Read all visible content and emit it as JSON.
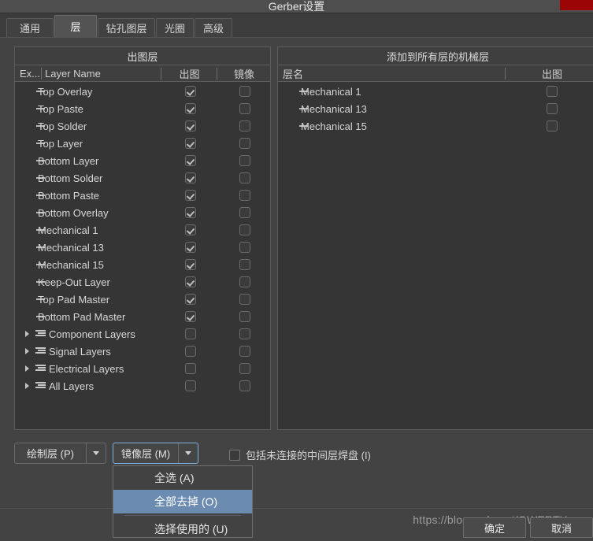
{
  "window": {
    "title": "Gerber设置",
    "close_icon": "close-icon",
    "accent_blue": "#6b8cb0",
    "close_red": "#9c0506"
  },
  "tabs": [
    {
      "label": "通用",
      "active": false
    },
    {
      "label": "层",
      "active": true
    },
    {
      "label": "钻孔图层",
      "active": false
    },
    {
      "label": "光圈",
      "active": false
    },
    {
      "label": "高级",
      "active": false
    }
  ],
  "left_panel": {
    "title": "出图层",
    "columns": [
      "Ex...",
      "Layer Name",
      "出图",
      "镜像"
    ],
    "rows": [
      {
        "name": "Top Overlay",
        "type": "layer",
        "plot": true,
        "mirror": false
      },
      {
        "name": "Top Paste",
        "type": "layer",
        "plot": true,
        "mirror": false
      },
      {
        "name": "Top Solder",
        "type": "layer",
        "plot": true,
        "mirror": false
      },
      {
        "name": "Top Layer",
        "type": "layer",
        "plot": true,
        "mirror": false
      },
      {
        "name": "Bottom Layer",
        "type": "layer",
        "plot": true,
        "mirror": false
      },
      {
        "name": "Bottom Solder",
        "type": "layer",
        "plot": true,
        "mirror": false
      },
      {
        "name": "Bottom Paste",
        "type": "layer",
        "plot": true,
        "mirror": false
      },
      {
        "name": "Bottom Overlay",
        "type": "layer",
        "plot": true,
        "mirror": false
      },
      {
        "name": "Mechanical 1",
        "type": "layer",
        "plot": true,
        "mirror": false
      },
      {
        "name": "Mechanical 13",
        "type": "layer",
        "plot": true,
        "mirror": false
      },
      {
        "name": "Mechanical 15",
        "type": "layer",
        "plot": true,
        "mirror": false
      },
      {
        "name": "Keep-Out Layer",
        "type": "layer",
        "plot": true,
        "mirror": false
      },
      {
        "name": "Top Pad Master",
        "type": "layer",
        "plot": true,
        "mirror": false
      },
      {
        "name": "Bottom Pad Master",
        "type": "layer",
        "plot": true,
        "mirror": false
      },
      {
        "name": "Component Layers",
        "type": "group",
        "plot": false,
        "mirror": false
      },
      {
        "name": "Signal Layers",
        "type": "group",
        "plot": false,
        "mirror": false
      },
      {
        "name": "Electrical Layers",
        "type": "group",
        "plot": false,
        "mirror": false
      },
      {
        "name": "All Layers",
        "type": "group",
        "plot": false,
        "mirror": false
      }
    ]
  },
  "right_panel": {
    "title": "添加到所有层的机械层",
    "columns": [
      "层名",
      "出图"
    ],
    "rows": [
      {
        "name": "Mechanical 1",
        "type": "layer",
        "plot": false
      },
      {
        "name": "Mechanical 13",
        "type": "layer",
        "plot": false
      },
      {
        "name": "Mechanical 15",
        "type": "layer",
        "plot": false
      }
    ]
  },
  "controls": {
    "plot_layers_button": "绘制层 (P)",
    "mirror_layers_button": "镜像层 (M)",
    "include_option": "包括未连接的中间层焊盘 (I)",
    "include_option_checked": false
  },
  "menu": {
    "items": [
      {
        "label": "全选 (A)",
        "selected": false
      },
      {
        "label": "全部去掉 (O)",
        "selected": true
      },
      {
        "label": "选择使用的 (U)",
        "selected": false
      }
    ]
  },
  "footer": {
    "watermark": "https://blog.csdn.net/QWERTYzxw",
    "ok_button": "确定",
    "cancel_button": "取消"
  }
}
